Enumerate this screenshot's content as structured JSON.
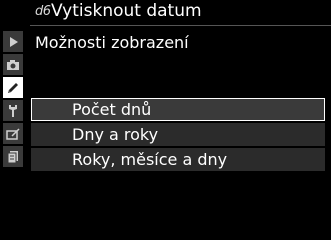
{
  "header": {
    "code": "d6",
    "title": "Vytisknout datum"
  },
  "subtitle": "Možnosti zobrazení",
  "sidebar": {
    "tabs": [
      {
        "icon": "play-icon",
        "active": false
      },
      {
        "icon": "camera-icon",
        "active": false
      },
      {
        "icon": "pencil-icon",
        "active": true
      },
      {
        "icon": "wrench-icon",
        "active": false
      },
      {
        "icon": "retouch-icon",
        "active": false
      },
      {
        "icon": "my-menu-icon",
        "active": false
      }
    ]
  },
  "options": [
    {
      "label": "Počet dnů",
      "selected": true
    },
    {
      "label": "Dny a roky",
      "selected": false
    },
    {
      "label": "Roky, měsíce a dny",
      "selected": false
    }
  ]
}
